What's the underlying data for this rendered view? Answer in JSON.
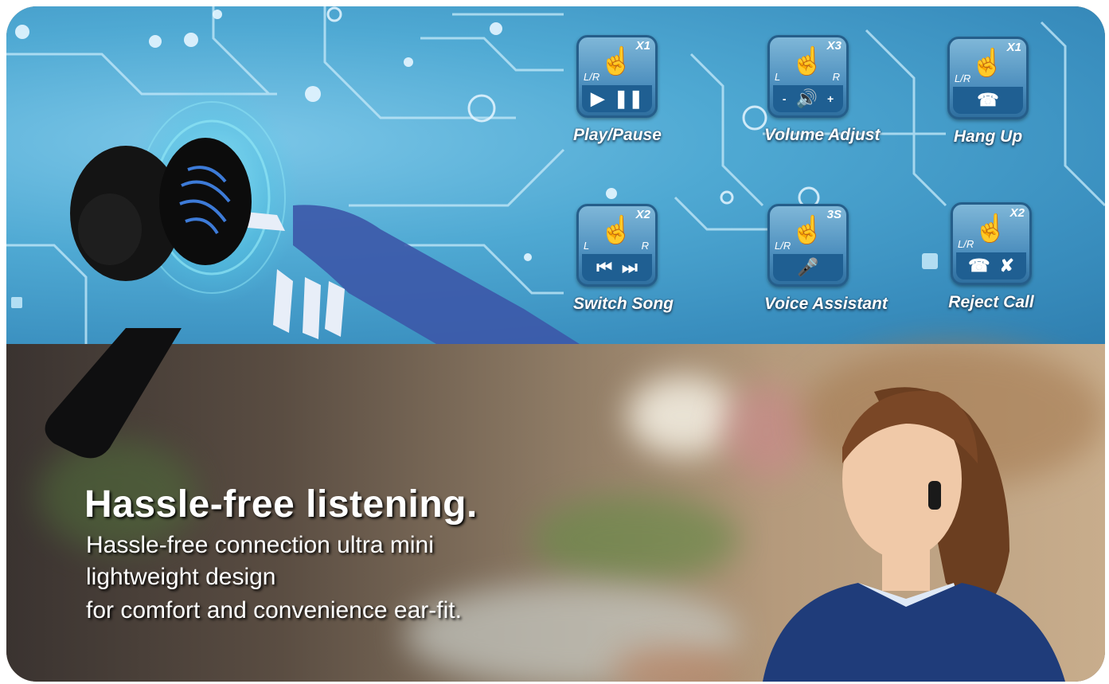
{
  "controls": [
    {
      "label": "Play/Pause",
      "count": "X1",
      "side_left": "L/R",
      "side_right": "",
      "icon": "play-pause-icon",
      "glyphs": [
        "▶",
        "❚❚"
      ]
    },
    {
      "label": "Volume Adjust",
      "count": "X3",
      "side_left": "L",
      "side_right": "R",
      "icon": "volume-icon",
      "glyphs": [
        "-",
        "🔊",
        "+"
      ]
    },
    {
      "label": "Hang Up",
      "count": "X1",
      "side_left": "L/R",
      "side_right": "",
      "icon": "phone-icon",
      "glyphs": [
        "☎"
      ]
    },
    {
      "label": "Switch Song",
      "count": "X2",
      "side_left": "L",
      "side_right": "R",
      "icon": "skip-icon",
      "glyphs": [
        "⏮",
        "⏭"
      ]
    },
    {
      "label": "Voice Assistant",
      "count": "3S",
      "side_left": "L/R",
      "side_right": "",
      "icon": "microphone-icon",
      "glyphs": [
        "🎤"
      ]
    },
    {
      "label": "Reject Call",
      "count": "X2",
      "side_left": "L/R",
      "side_right": "",
      "icon": "reject-call-icon",
      "glyphs": [
        "☎",
        "✘"
      ]
    }
  ],
  "headline": "Hassle-free listening.",
  "subtext": [
    "Hassle-free connection ultra mini",
    "lightweight design",
    "for comfort and convenience ear-fit."
  ],
  "colors": {
    "banner_blue": "#4fa9d3",
    "tile_bar": "#1f5f92",
    "text_white": "#ffffff"
  }
}
